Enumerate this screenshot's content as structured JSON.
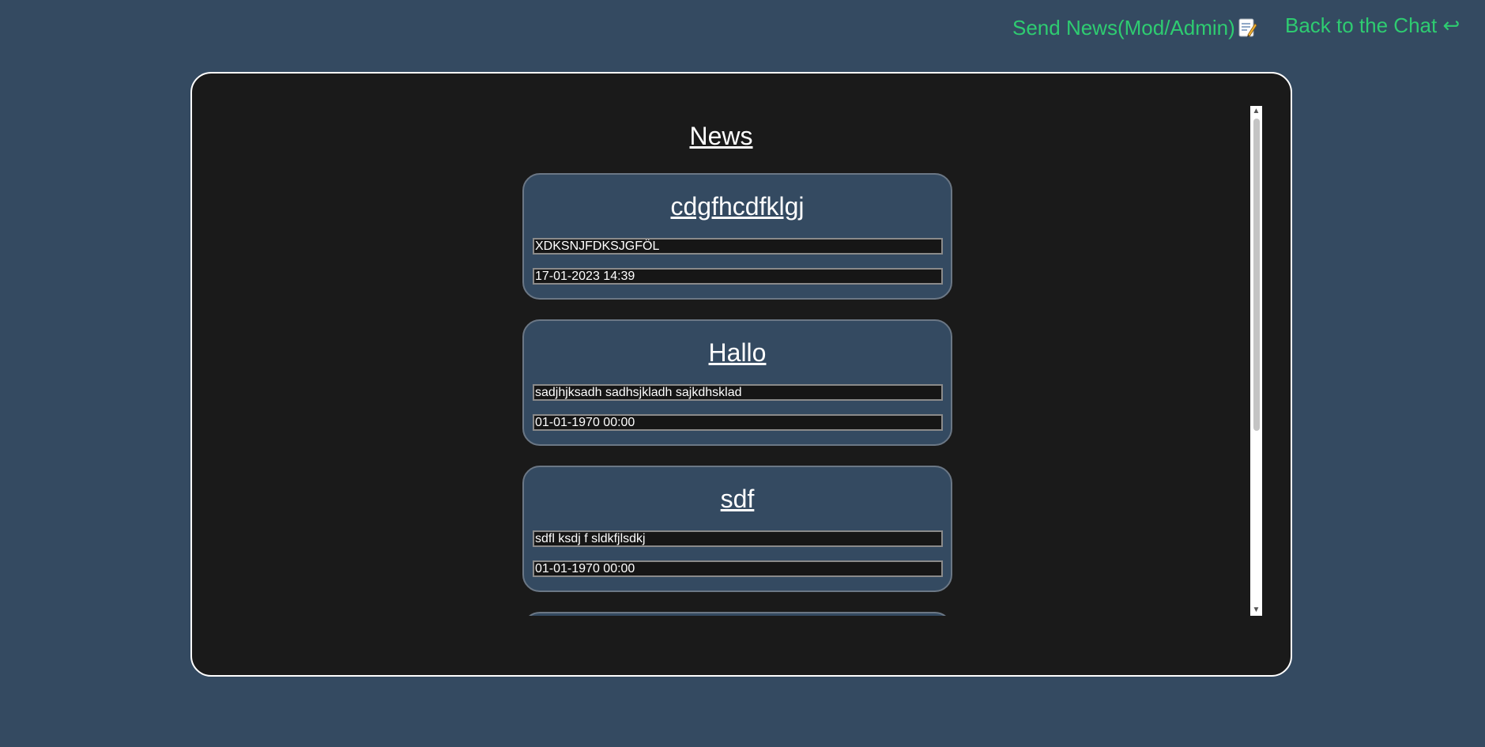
{
  "header": {
    "send_news_label": "Send News(Mod/Admin)",
    "send_news_icon": "memo-icon",
    "back_to_chat_label": "Back to the Chat ↩"
  },
  "news": {
    "title": "News",
    "items": [
      {
        "title": "cdgfhcdfklgj",
        "text": "XDKSNJFDKSJGFÖL",
        "date": "17-01-2023 14:39"
      },
      {
        "title": "Hallo",
        "text": "sadjhjksadh sadhsjkladh sajkdhsklad",
        "date": "01-01-1970 00:00"
      },
      {
        "title": "sdf",
        "text": "sdfl ksdj f sldkfjlsdkj",
        "date": "01-01-1970 00:00"
      }
    ]
  },
  "colors": {
    "background": "#344a61",
    "panel": "#1a1a1a",
    "link": "#2ecc71",
    "card": "#344a61"
  }
}
